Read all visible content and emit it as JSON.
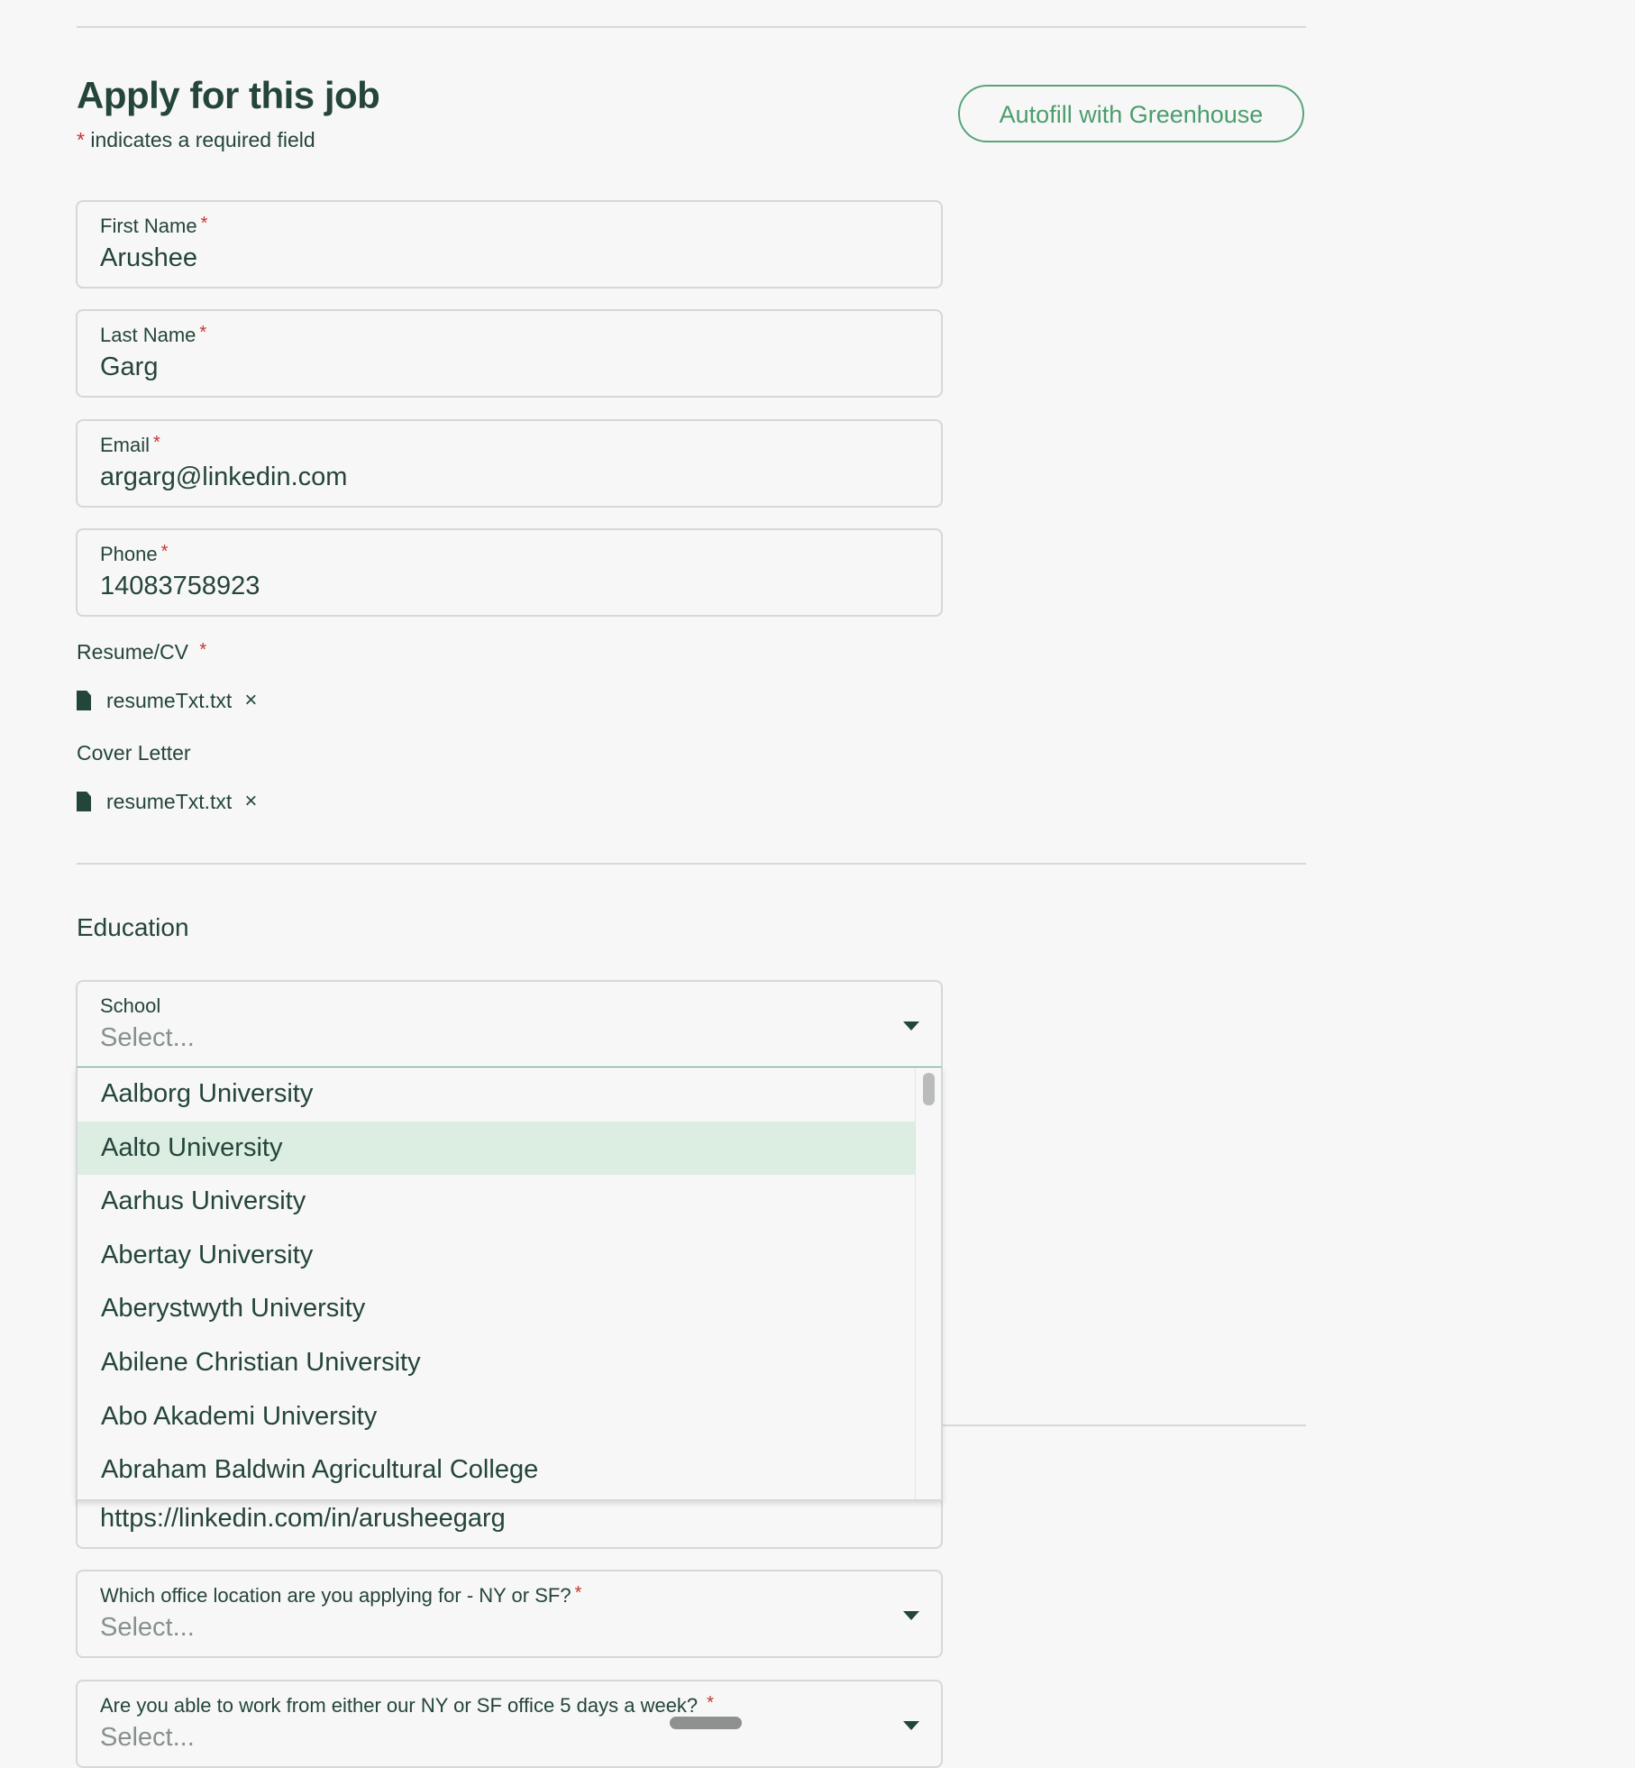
{
  "header": {
    "title": "Apply for this job",
    "required_star": "*",
    "required_note": "indicates a required field",
    "autofill_label": "Autofill with Greenhouse"
  },
  "fields": {
    "first_name": {
      "label": "First Name",
      "value": "Arushee"
    },
    "last_name": {
      "label": "Last Name",
      "value": "Garg"
    },
    "email": {
      "label": "Email",
      "value": "argarg@linkedin.com"
    },
    "phone": {
      "label": "Phone",
      "value": "14083758923"
    },
    "linkedin": {
      "value": "https://linkedin.com/in/arusheegarg"
    },
    "office_location": {
      "label": "Which office location are you applying for - NY or SF?",
      "placeholder": "Select..."
    },
    "five_days": {
      "label": "Are you able to work from either our NY or SF office 5 days a week?",
      "placeholder": "Select..."
    }
  },
  "resume": {
    "label": "Resume/CV",
    "file_name": "resumeTxt.txt",
    "remove": "×"
  },
  "cover_letter": {
    "label": "Cover Letter",
    "file_name": "resumeTxt.txt",
    "remove": "×"
  },
  "education": {
    "heading": "Education",
    "school_label": "School",
    "school_placeholder": "Select...",
    "options": [
      "Aalborg University",
      "Aalto University",
      "Aarhus University",
      "Abertay University",
      "Aberystwyth University",
      "Abilene Christian University",
      "Abo Akademi University",
      "Abraham Baldwin Agricultural College"
    ],
    "highlighted_option": "Aalto University"
  },
  "colors": {
    "text": "#24453a",
    "accent_green": "#4b9d6c",
    "required_red": "#c5362f",
    "highlight_bg": "#dcede2",
    "page_bg": "#f7f7f7"
  }
}
